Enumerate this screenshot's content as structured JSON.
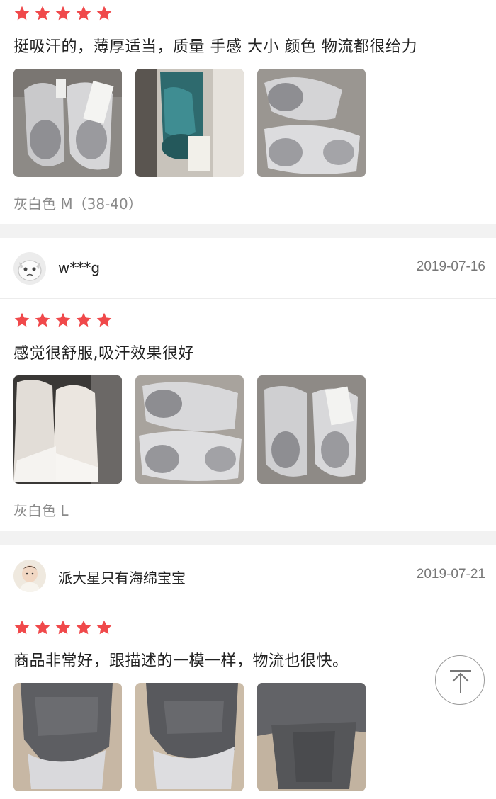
{
  "reviews": [
    {
      "text": "挺吸汗的，薄厚适当，质量 手感 大小 颜色 物流都很给力",
      "variant": "灰白色 M（38-40）",
      "rating": 5
    },
    {
      "username": "w***g",
      "date": "2019-07-16",
      "text": "感觉很舒服,吸汗效果很好",
      "variant": "灰白色 L",
      "rating": 5
    },
    {
      "username": "派大星只有海绵宝宝",
      "date": "2019-07-21",
      "text": "商品非常好，跟描述的一模一样，物流也很快。",
      "rating": 5
    }
  ],
  "colors": {
    "star": "#f0494b",
    "divider_bg": "#f2f2f2",
    "date": "#777777",
    "variant": "#8a8a8a"
  },
  "icons": {
    "rating": "star-icon",
    "scroll_top": "arrow-up-icon"
  }
}
